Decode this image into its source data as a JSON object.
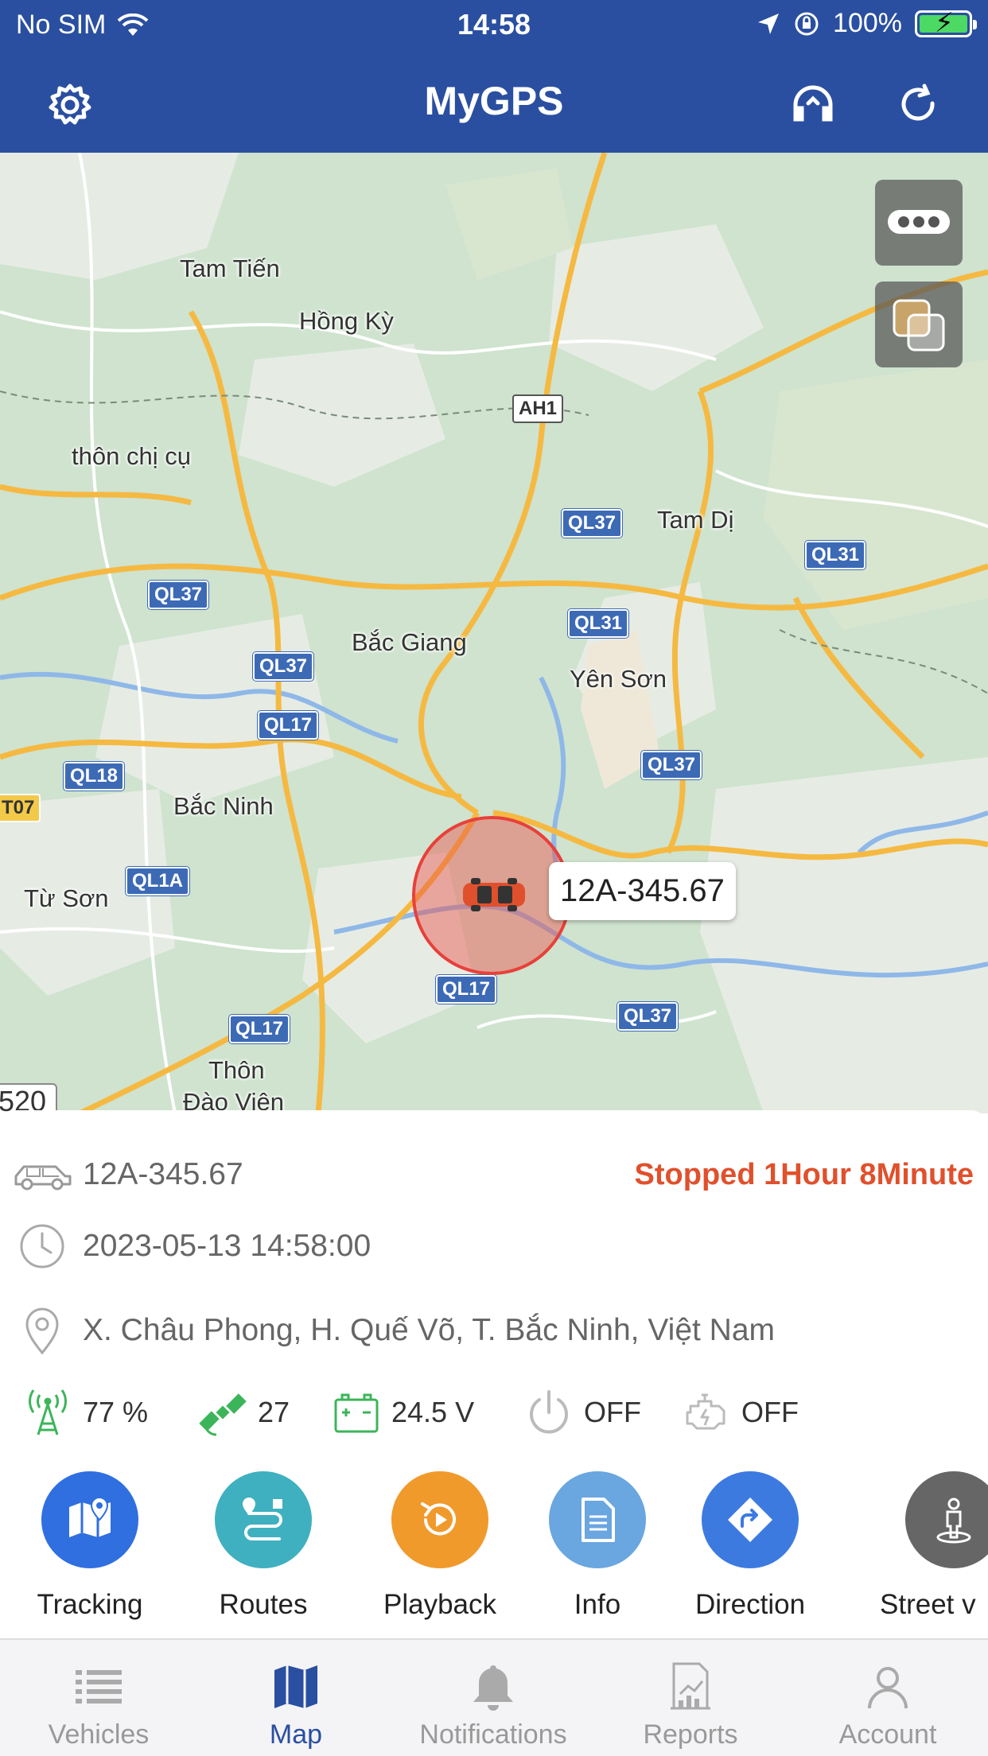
{
  "status_bar": {
    "carrier": "No SIM",
    "time": "14:58",
    "battery_percent": "100%",
    "battery_level": 1.0
  },
  "header": {
    "title": "MyGPS"
  },
  "map": {
    "places": [
      "Tam Tiến",
      "Hồng Kỳ",
      "thôn chị cụ",
      "Tam Dị",
      "Bắc Giang",
      "Yên Sơn",
      "Bắc Ninh",
      "Từ Sơn",
      "Thôn",
      "Đào Viên"
    ],
    "shields": [
      "AH1",
      "QL37",
      "QL31",
      "QL37",
      "QL31",
      "QL37",
      "QL17",
      "QL37",
      "QL18",
      "T07",
      "QL1A",
      "QL17",
      "QL17",
      "QL37"
    ],
    "scale_text": "520",
    "vehicle_label": "12A-345.67"
  },
  "panel": {
    "plate": "12A-345.67",
    "status": "Stopped 1Hour 8Minute",
    "datetime": "2023-05-13 14:58:00",
    "address": "X. Châu Phong, H. Quế Võ, T. Bắc Ninh, Việt Nam",
    "metrics": {
      "signal": "77 %",
      "satellites": "27",
      "voltage": "24.5 V",
      "power": "OFF",
      "engine": "OFF"
    },
    "actions": [
      {
        "label": "Tracking",
        "color": "#2f6fe0"
      },
      {
        "label": "Routes",
        "color": "#3fb0c0"
      },
      {
        "label": "Playback",
        "color": "#f09a2c"
      },
      {
        "label": "Info",
        "color": "#6aa6e0"
      },
      {
        "label": "Direction",
        "color": "#3d7ae0"
      },
      {
        "label": "Street v",
        "color": "#666666"
      }
    ]
  },
  "tabs": [
    {
      "label": "Vehicles"
    },
    {
      "label": "Map"
    },
    {
      "label": "Notifications"
    },
    {
      "label": "Reports"
    },
    {
      "label": "Account"
    }
  ],
  "colors": {
    "header_bg": "#2a4fa0",
    "status_red": "#e0502c",
    "tab_active": "#2a4fa0",
    "tab_inactive": "#999999"
  }
}
